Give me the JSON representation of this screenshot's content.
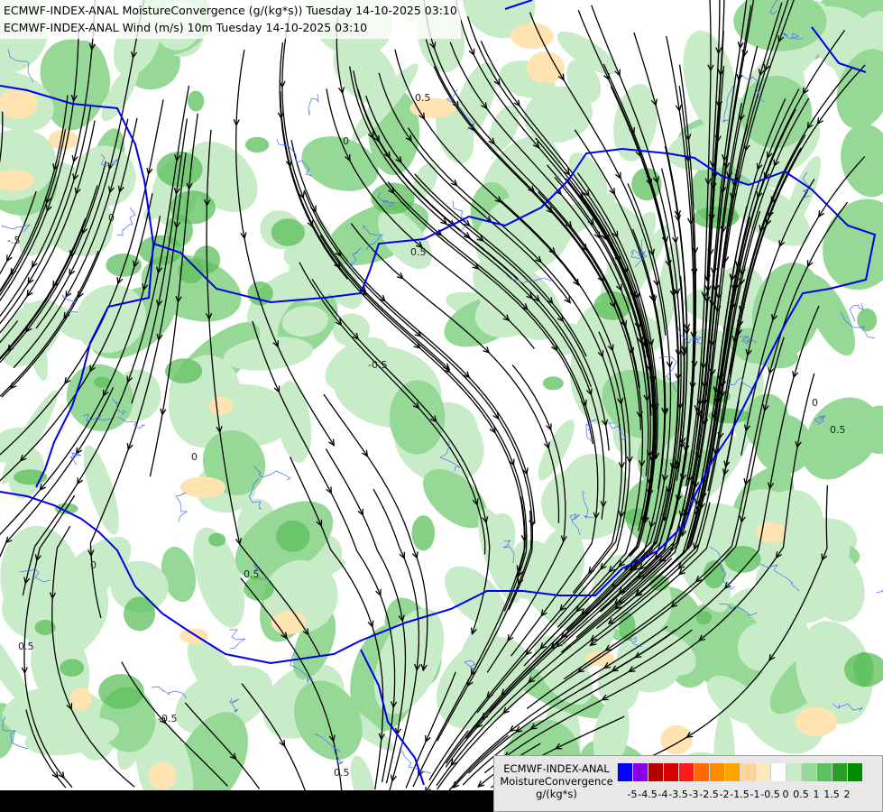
{
  "title_lines": [
    "ECMWF-INDEX-ANAL MoistureConvergence (g/(kg*s)) Tuesday 14-10-2025 03:10",
    "ECMWF-INDEX-ANAL Wind (m/s) 10m Tuesday 14-10-2025 03:10"
  ],
  "legend": {
    "model": "ECMWF-INDEX-ANAL",
    "parameter": "MoistureConvergence",
    "unit": "g/(kg*s)",
    "ticks": [
      "-5",
      "-4.5",
      "-4",
      "-3.5",
      "-3",
      "-2.5",
      "-2",
      "-1.5",
      "-1",
      "-0.5",
      "0",
      "0.5",
      "1",
      "1.5",
      "2"
    ],
    "colors": [
      "#0000ff",
      "#8a00e6",
      "#b40000",
      "#d80000",
      "#ff1a1a",
      "#ff6a00",
      "#ff8c00",
      "#ffa500",
      "#ffd59a",
      "#ffe8c0",
      "#ffffff",
      "#c8ecc8",
      "#96d896",
      "#5cc05c",
      "#28a028",
      "#008c00"
    ]
  },
  "map_colors": {
    "convergence_light": "#c8ecc8",
    "convergence_mid": "#96d896",
    "convergence_strong": "#5cc05c",
    "divergence_light": "#ffe3b0",
    "border": "#0000ee",
    "river": "#4a6cff",
    "streamline": "#000000"
  },
  "contour_labels": [
    "0.5",
    "0",
    "0.5",
    "-0.5",
    "0",
    "0.5",
    "0",
    "0.5",
    "-0.5",
    "0.5",
    "0",
    "0.5",
    "0",
    "-.5"
  ]
}
